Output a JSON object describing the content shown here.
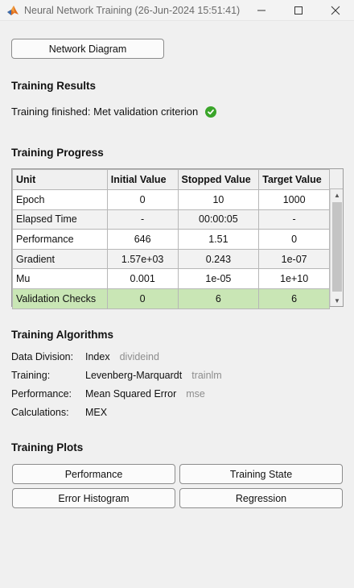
{
  "window": {
    "title": "Neural Network Training (26-Jun-2024 15:51:41)",
    "minimize_glyph": "—",
    "maximize_glyph": "☐",
    "close_glyph": "✕"
  },
  "buttons": {
    "network_diagram": "Network Diagram"
  },
  "results": {
    "heading": "Training Results",
    "status": "Training finished: Met validation criterion",
    "status_color": "#3aa52a"
  },
  "progress": {
    "heading": "Training Progress",
    "columns": [
      "Unit",
      "Initial Value",
      "Stopped Value",
      "Target Value"
    ],
    "rows": [
      {
        "unit": "Epoch",
        "initial": "0",
        "stopped": "10",
        "target": "1000"
      },
      {
        "unit": "Elapsed Time",
        "initial": "-",
        "stopped": "00:00:05",
        "target": "-"
      },
      {
        "unit": "Performance",
        "initial": "646",
        "stopped": "1.51",
        "target": "0"
      },
      {
        "unit": "Gradient",
        "initial": "1.57e+03",
        "stopped": "0.243",
        "target": "1e-07"
      },
      {
        "unit": "Mu",
        "initial": "0.001",
        "stopped": "1e-05",
        "target": "1e+10"
      },
      {
        "unit": "Validation Checks",
        "initial": "0",
        "stopped": "6",
        "target": "6"
      }
    ],
    "highlight_color": "#c9e6b5"
  },
  "algorithms": {
    "heading": "Training Algorithms",
    "rows": [
      {
        "label": "Data Division:",
        "name": "Index",
        "code": "divideind"
      },
      {
        "label": "Training:",
        "name": "Levenberg-Marquardt",
        "code": "trainlm"
      },
      {
        "label": "Performance:",
        "name": "Mean Squared Error",
        "code": "mse"
      },
      {
        "label": "Calculations:",
        "name": "MEX",
        "code": ""
      }
    ]
  },
  "plots": {
    "heading": "Training Plots",
    "performance": "Performance",
    "training_state": "Training State",
    "error_histogram": "Error Histogram",
    "regression": "Regression"
  }
}
